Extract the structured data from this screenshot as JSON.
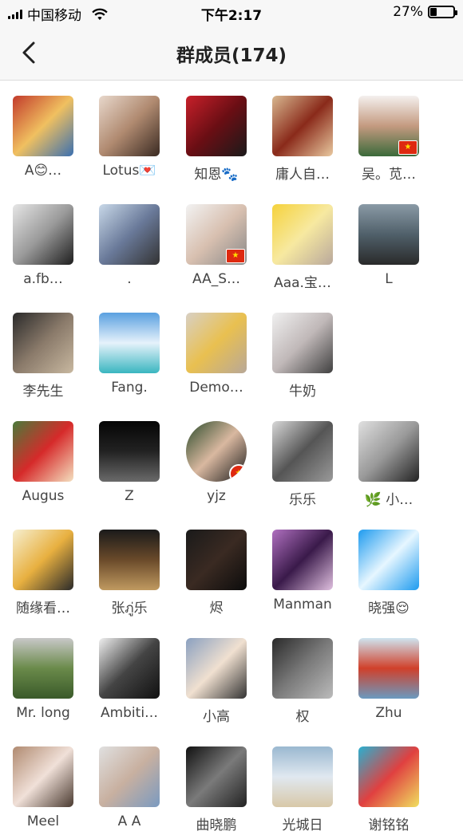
{
  "status": {
    "carrier": "中国移动",
    "time": "下午2:17",
    "battery": "27%",
    "battery_level": 0.27
  },
  "header": {
    "title": "群成员(174)"
  },
  "members": [
    {
      "name": "A😊…",
      "bg": "linear-gradient(135deg,#c23a2b,#f0c060,#3a6fb0)"
    },
    {
      "name": "Lotus💌",
      "bg": "linear-gradient(135deg,#e8d8cc,#b08a70,#3a2a22)"
    },
    {
      "name": "知恩🐾",
      "bg": "linear-gradient(135deg,#c8202a,#6a0e14,#1a1a1a)"
    },
    {
      "name": "庸人自…",
      "bg": "linear-gradient(135deg,#d8b890,#8a2a1a,#e9c9a0)"
    },
    {
      "name": "吴。苋…",
      "bg": "linear-gradient(180deg,#f4f0ee,#c49a80,#3b6a3a)",
      "flag": "sq"
    },
    {
      "name": "a.fb…",
      "bg": "linear-gradient(135deg,#e6e6e6,#9a9a9a,#1e1e1e)"
    },
    {
      "name": ".",
      "bg": "linear-gradient(135deg,#c8d8e8,#6a7a9a,#333)"
    },
    {
      "name": "AA_S…",
      "bg": "linear-gradient(135deg,#f2f2f2,#d8c0b0,#888)",
      "flag": "sq"
    },
    {
      "name": "Aaa.宝…",
      "bg": "linear-gradient(135deg,#f5d23c,#f7e9a0,#b9a89c)"
    },
    {
      "name": "L",
      "bg": "linear-gradient(180deg,#8a9aa6,#50606a,#2a2a2a)"
    },
    {
      "name": "李先生",
      "bg": "linear-gradient(135deg,#2a2a2a,#8a7a6a,#c8b8a0)"
    },
    {
      "name": "Fang.",
      "bg": "linear-gradient(180deg,#5aa0e0,#e6f2fb,#3ab6c0)"
    },
    {
      "name": "Demo…",
      "bg": "linear-gradient(135deg,#d8d0c4,#e9c050,#b8a898)"
    },
    {
      "name": "牛奶",
      "bg": "linear-gradient(135deg,#f0f0f0,#c0b8b8,#404040)"
    },
    {
      "name": "Augus",
      "bg": "linear-gradient(135deg,#4a7a3a,#d62a2a,#f4e0c0)"
    },
    {
      "name": "Z",
      "bg": "linear-gradient(180deg,#050505,#222,#6a6a6a)"
    },
    {
      "name": "yjz",
      "bg": "linear-gradient(135deg,#2a4a2a,#d9b8a0,#1a1a1a)",
      "round": true,
      "flag": "round"
    },
    {
      "name": "乐乐",
      "bg": "linear-gradient(135deg,#d8d8d8,#555,#9a9a9a)"
    },
    {
      "name": "🌿 小…",
      "bg": "linear-gradient(135deg,#e0e0e0,#999,#222)"
    },
    {
      "name": "随缘看…",
      "bg": "linear-gradient(135deg,#f6efd0,#e8b040,#2a2a2a)"
    },
    {
      "name": "张ภู่乐",
      "bg": "linear-gradient(180deg,#1a1a1a,#6a4a2a,#c09a60)"
    },
    {
      "name": "烬",
      "bg": "linear-gradient(135deg,#1a1a1a,#3a2a22,#0c0c0c)"
    },
    {
      "name": "Manman",
      "bg": "linear-gradient(135deg,#b070c0,#3a1a4a,#e0c0e0)"
    },
    {
      "name": "晓强😌",
      "bg": "linear-gradient(135deg,#1e9bef,#e6f6ff,#1e9bef)"
    },
    {
      "name": "Mr. long",
      "bg": "linear-gradient(180deg,#c8c8c8,#6a8a4a,#3a5a2a)"
    },
    {
      "name": "Ambiti…",
      "bg": "linear-gradient(135deg,#f0f0f0,#444,#111)"
    },
    {
      "name": "小高",
      "bg": "linear-gradient(135deg,#8aa0c0,#f0e0d0,#333)"
    },
    {
      "name": "权",
      "bg": "linear-gradient(135deg,#2a2a2a,#7a7a7a,#bbb)"
    },
    {
      "name": "Zhu",
      "bg": "linear-gradient(180deg,#cfe4f0,#d0402a,#6a9ac0)"
    },
    {
      "name": "Meel",
      "bg": "linear-gradient(135deg,#b08a70,#f0e0d8,#4a3a30)"
    },
    {
      "name": "A A",
      "bg": "linear-gradient(135deg,#e0e0e0,#c8b0a0,#7a9ac0)"
    },
    {
      "name": "曲晓鹏",
      "bg": "linear-gradient(135deg,#111,#7a7a7a,#222)"
    },
    {
      "name": "光城日",
      "bg": "linear-gradient(180deg,#9ab8d0,#e0e8f0,#d8c8a8)"
    },
    {
      "name": "谢铭铭",
      "bg": "linear-gradient(135deg,#2ab0d0,#e04040,#f0e060)"
    }
  ]
}
